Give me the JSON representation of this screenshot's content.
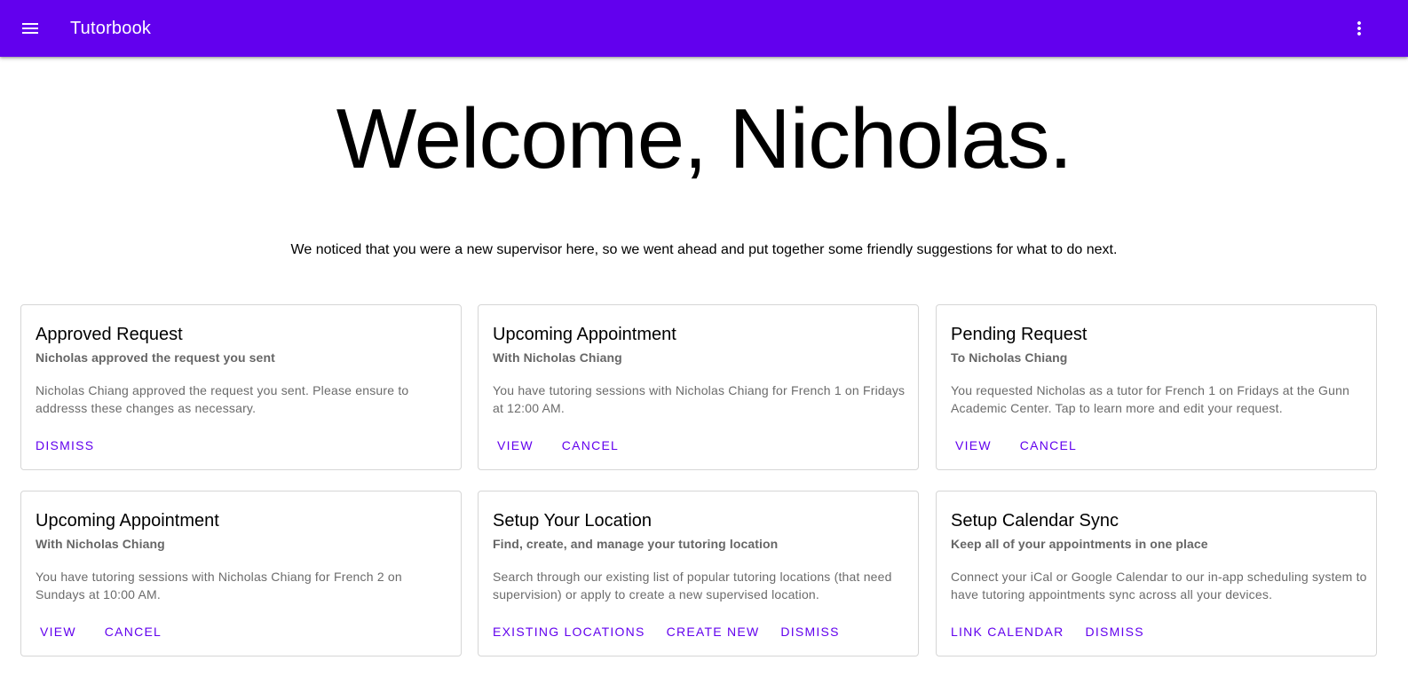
{
  "appbar": {
    "title": "Tutorbook",
    "menu_icon": "menu-icon",
    "more_icon": "more-vert-icon",
    "color": "#6200ee"
  },
  "welcome": {
    "heading": "Welcome, Nicholas.",
    "intro": "We noticed that you were a new supervisor here, so we went ahead and put together some friendly suggestions for what to do next."
  },
  "cards": [
    {
      "title": "Approved Request",
      "subtitle": "Nicholas approved the request you sent",
      "body": "Nicholas Chiang approved the request you sent. Please ensure to addresss these changes as necessary.",
      "actions": [
        "Dismiss"
      ]
    },
    {
      "title": "Upcoming Appointment",
      "subtitle": "With Nicholas Chiang",
      "body": "You have tutoring sessions with Nicholas Chiang for French 1 on Fridays at 12:00 AM.",
      "actions": [
        "View",
        "Cancel"
      ]
    },
    {
      "title": "Pending Request",
      "subtitle": "To Nicholas Chiang",
      "body": "You requested Nicholas as a tutor for French 1 on Fridays at the Gunn Academic Center. Tap to learn more and edit your request.",
      "actions": [
        "View",
        "Cancel"
      ]
    },
    {
      "title": "Upcoming Appointment",
      "subtitle": "With Nicholas Chiang",
      "body": "You have tutoring sessions with Nicholas Chiang for French 2 on Sundays at 10:00 AM.",
      "actions": [
        "View",
        "Cancel"
      ]
    },
    {
      "title": "Setup Your Location",
      "subtitle": "Find, create, and manage your tutoring location",
      "body": "Search through our existing list of popular tutoring locations (that need supervision) or apply to create a new supervised location.",
      "actions": [
        "Existing Locations",
        "Create New",
        "Dismiss"
      ]
    },
    {
      "title": "Setup Calendar Sync",
      "subtitle": "Keep all of your appointments in one place",
      "body": "Connect your iCal or Google Calendar to our in-app scheduling system to have tutoring appointments sync across all your devices.",
      "actions": [
        "Link Calendar",
        "Dismiss"
      ]
    }
  ]
}
